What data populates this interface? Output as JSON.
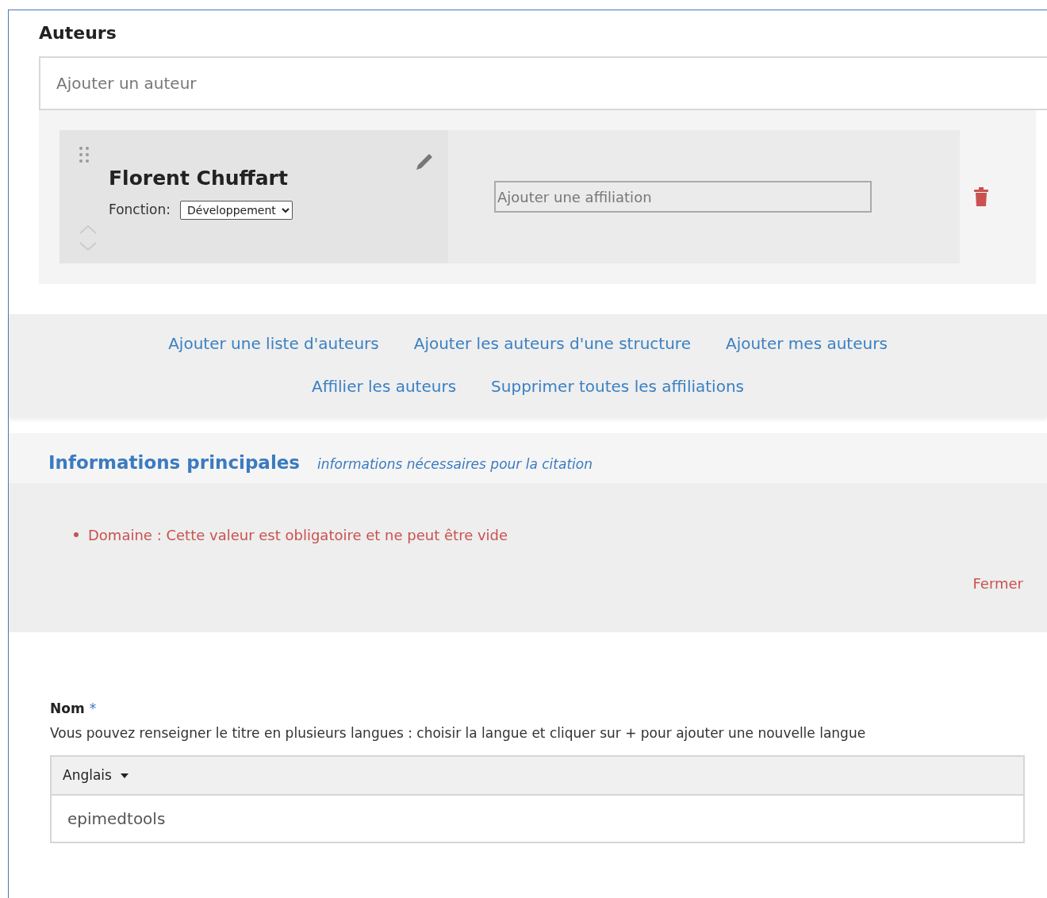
{
  "section_title": "Auteurs",
  "author_search": {
    "placeholder": "Ajouter un auteur"
  },
  "authors": [
    {
      "name": "Florent Chuffart",
      "function_label": "Fonction:",
      "function_value": "Développement",
      "affiliation": {
        "placeholder": "Ajouter une affiliation"
      }
    }
  ],
  "author_actions": [
    {
      "label": "Ajouter une liste d'auteurs"
    },
    {
      "label": "Ajouter les auteurs d'une structure"
    },
    {
      "label": "Ajouter mes auteurs"
    },
    {
      "label": "Affilier les auteurs"
    },
    {
      "label": "Supprimer toutes les affiliations"
    }
  ],
  "info_section": {
    "title": "Informations principales",
    "subtitle": "informations nécessaires pour la citation",
    "errors": [
      "Domaine : Cette valeur est obligatoire et ne peut être vide"
    ],
    "close_label": "Fermer"
  },
  "name_field": {
    "label": "Nom",
    "required_mark": "*",
    "help": "Vous pouvez renseigner le titre en plusieurs langues : choisir la langue et cliquer sur + pour ajouter une nouvelle langue",
    "language": "Anglais",
    "value": "epimedtools"
  }
}
